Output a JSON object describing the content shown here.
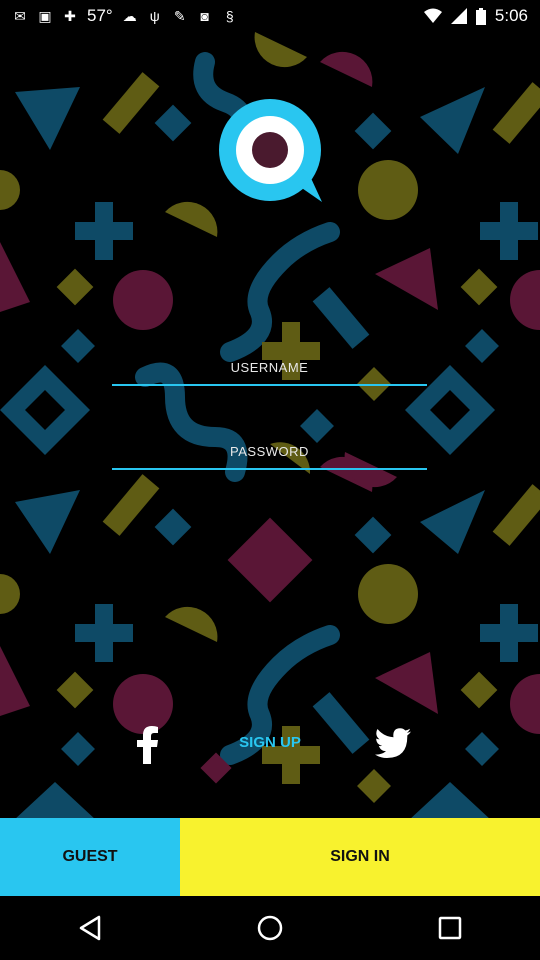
{
  "status_bar": {
    "time": "5:06",
    "temperature": "57°",
    "icons_left": [
      "mail-icon",
      "image-icon",
      "game-icon",
      "weather-icon",
      "usb-icon",
      "tools-icon",
      "app-icon",
      "s-app-icon"
    ],
    "icons_right": [
      "wifi-icon",
      "signal-icon",
      "battery-icon"
    ]
  },
  "login": {
    "username_placeholder": "USERNAME",
    "password_placeholder": "PASSWORD"
  },
  "social": {
    "signup_label": "SIGN UP",
    "facebook_icon": "facebook-icon",
    "twitter_icon": "twitter-icon"
  },
  "buttons": {
    "guest_label": "GUEST",
    "signin_label": "SIGN IN"
  },
  "colors": {
    "cyan": "#29c6f0",
    "yellow": "#f8f22e",
    "teal_shape": "#0e4a66",
    "olive_shape": "#5f5c14",
    "maroon_shape": "#5a1636"
  },
  "nav": [
    "back-icon",
    "home-icon",
    "recents-icon"
  ]
}
